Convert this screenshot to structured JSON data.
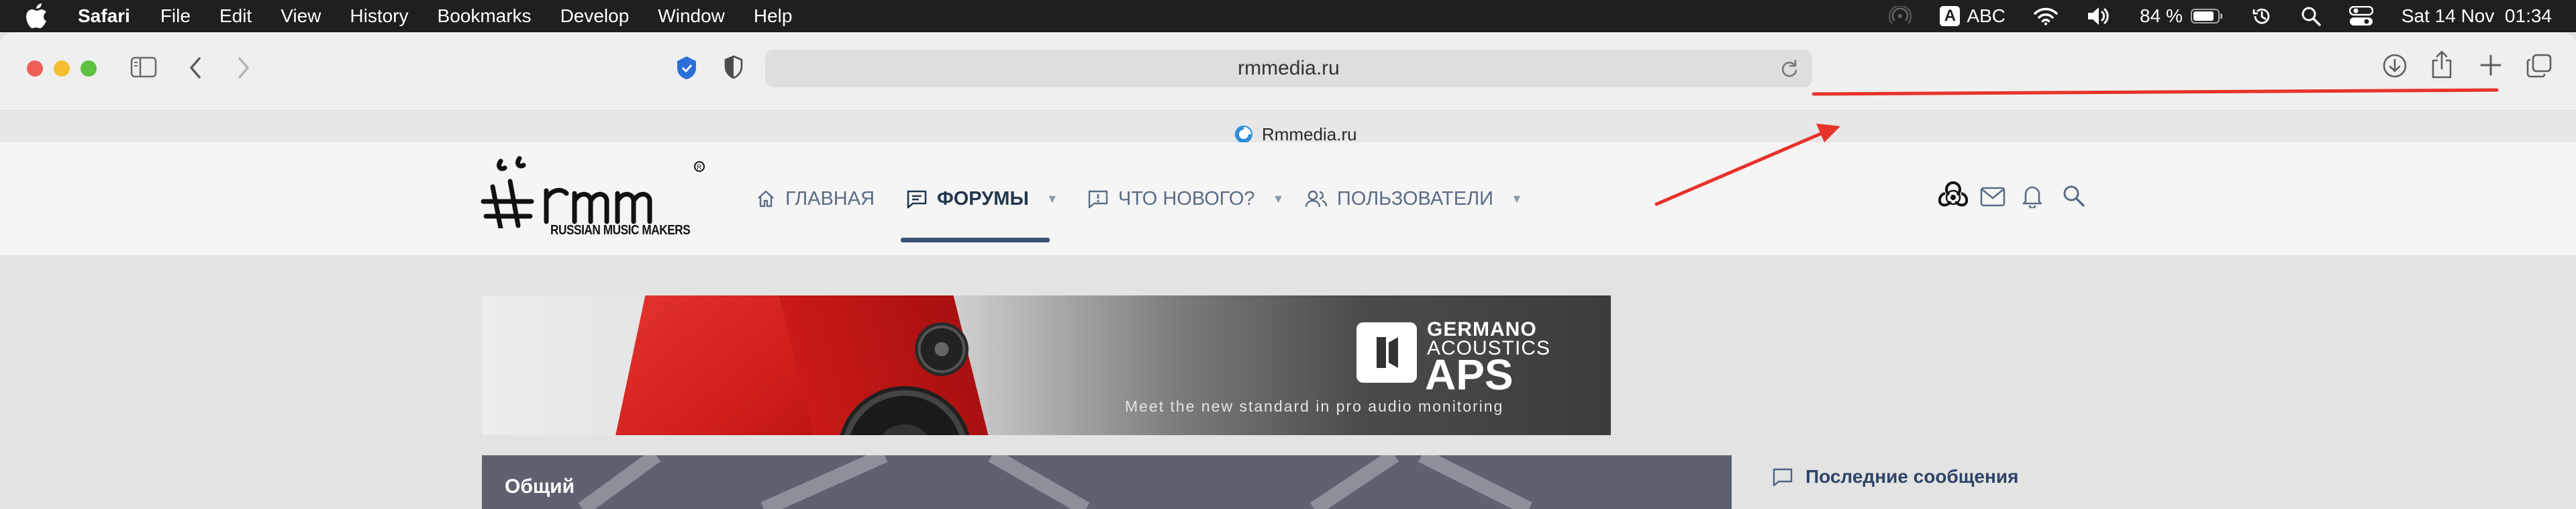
{
  "menubar": {
    "app_name": "Safari",
    "items": [
      "File",
      "Edit",
      "View",
      "History",
      "Bookmarks",
      "Develop",
      "Window",
      "Help"
    ],
    "input_source": "ABC",
    "battery": "84 %",
    "datetime": "Sat 14 Nov  01:34"
  },
  "browser": {
    "url": "rmmedia.ru",
    "tab_title": "Rmmedia.ru"
  },
  "site": {
    "logo_text": "rmm",
    "logo_tagline": "RUSSIAN MUSIC MAKERS",
    "nav": [
      {
        "label": "ГЛАВНАЯ"
      },
      {
        "label": "ФОРУМЫ"
      },
      {
        "label": "ЧТО НОВОГО?"
      },
      {
        "label": "ПОЛЬЗОВАТЕЛИ"
      }
    ]
  },
  "banner": {
    "brand_line1": "GERMANO",
    "brand_line2": "ACOUSTICS",
    "brand_line3": "APS",
    "tagline": "Meet the new standard in pro audio monitoring"
  },
  "content": {
    "forum_block_title": "Общий",
    "sidebar_title": "Последние сообщения"
  },
  "colors": {
    "nav_text": "#5a6c86",
    "nav_active": "#23374f",
    "annotation": "#e8322a"
  }
}
